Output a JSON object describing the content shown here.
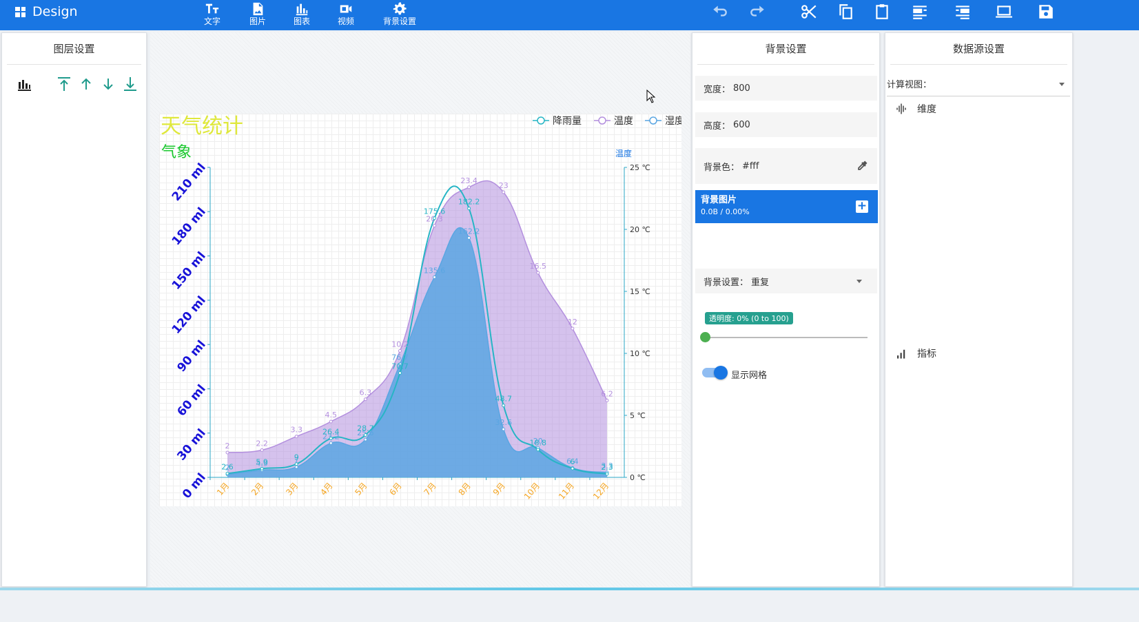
{
  "app": {
    "title": "Design"
  },
  "toolbar": {
    "text_label": "文字",
    "image_label": "图片",
    "chart_label": "图表",
    "video_label": "视频",
    "bg_settings_label": "背景设置"
  },
  "left_panel": {
    "title": "图层设置"
  },
  "bg_panel": {
    "title": "背景设置",
    "width_label": "宽度：",
    "width_value": "800",
    "height_label": "高度：",
    "height_value": "600",
    "color_label": "背景色：",
    "color_value": "#fff",
    "image_title": "背景图片",
    "image_progress": "0.0B / 0.00%",
    "repeat_label": "背景设置：",
    "repeat_value": "重复",
    "opacity_badge": "透明度: 0% (0 to 100)",
    "opacity_value": 0,
    "grid_label": "显示网格",
    "grid_on": true
  },
  "ds_panel": {
    "title": "数据源设置",
    "view_label": "计算视图：",
    "dimension_label": "维度",
    "metric_label": "指标"
  },
  "colors": {
    "primary": "#1976e3",
    "rain": "#26b5c5",
    "temp": "#b38fde",
    "humidity": "#5aa6e2",
    "title": "#dfe83c",
    "subtitle": "#19c82d",
    "left_axis": "#1812d8",
    "x_axis": "#f5a623"
  },
  "chart_data": {
    "type": "area",
    "title": "天气统计",
    "subtitle": "气象",
    "categories": [
      "1月",
      "2月",
      "3月",
      "4月",
      "5月",
      "6月",
      "7月",
      "8月",
      "9月",
      "10月",
      "11月",
      "12月"
    ],
    "y_left": {
      "ticks": [
        "0 ml",
        "30 ml",
        "60 ml",
        "90 ml",
        "120 ml",
        "150 ml",
        "180 ml",
        "210 ml"
      ],
      "min": 0,
      "max": 210
    },
    "y_right": {
      "name": "温度",
      "ticks": [
        "0 ℃",
        "5 ℃",
        "10 ℃",
        "15 ℃",
        "20 ℃",
        "25 ℃"
      ],
      "min": 0,
      "max": 25
    },
    "legend": [
      "降雨量",
      "温度",
      "湿度"
    ],
    "series": [
      {
        "name": "降雨量",
        "axis": "left",
        "values": [
          2.6,
          5.9,
          9.0,
          26.4,
          28.7,
          70.7,
          175.6,
          182.2,
          48.7,
          18.8,
          6.0,
          2.3
        ]
      },
      {
        "name": "温度",
        "axis": "right",
        "values": [
          2.0,
          2.2,
          3.3,
          4.5,
          6.3,
          10.2,
          20.3,
          23.4,
          23.0,
          16.5,
          12.0,
          6.2
        ]
      },
      {
        "name": "湿度",
        "axis": "left",
        "values": [
          2.0,
          4.9,
          7.0,
          23.2,
          25.6,
          76.7,
          135.6,
          162.2,
          32.6,
          20.0,
          6.4,
          3.3
        ]
      }
    ]
  }
}
